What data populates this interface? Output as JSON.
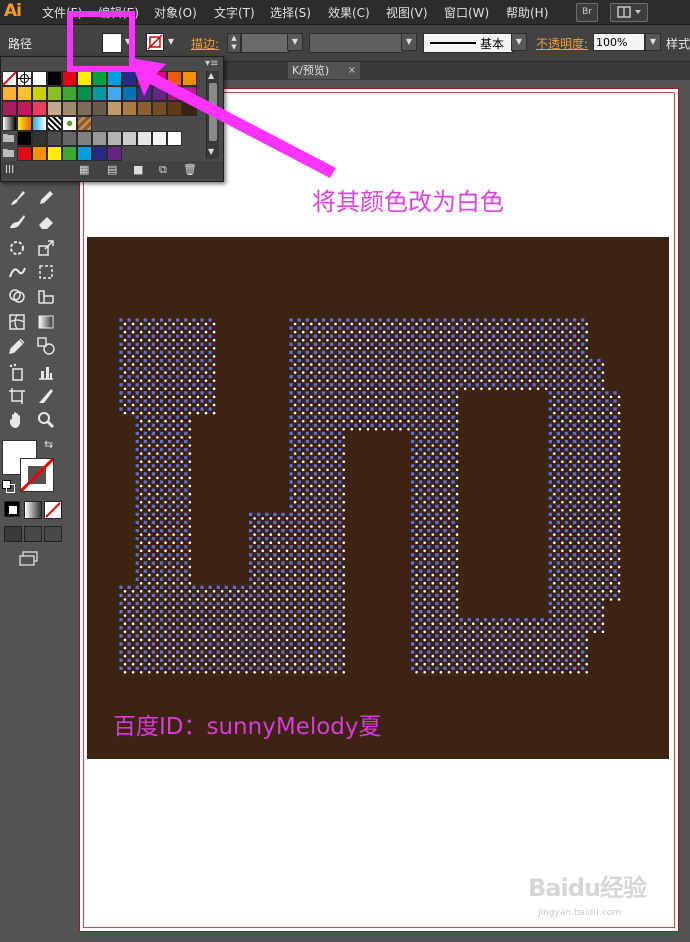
{
  "app": {
    "logo": "Ai"
  },
  "menubar": {
    "items": [
      {
        "label": "文件(F)",
        "name": "menu-file"
      },
      {
        "label": "编辑(E)",
        "name": "menu-edit"
      },
      {
        "label": "对象(O)",
        "name": "menu-object"
      },
      {
        "label": "文字(T)",
        "name": "menu-type"
      },
      {
        "label": "选择(S)",
        "name": "menu-select"
      },
      {
        "label": "效果(C)",
        "name": "menu-effect"
      },
      {
        "label": "视图(V)",
        "name": "menu-view"
      },
      {
        "label": "窗口(W)",
        "name": "menu-window"
      },
      {
        "label": "帮助(H)",
        "name": "menu-help"
      }
    ],
    "bridge_label": "Br"
  },
  "controlbar": {
    "selection_label": "路径",
    "stroke_label": "描边:",
    "brush_label": "基本",
    "opacity_label": "不透明度:",
    "opacity_value": "100%",
    "style_label": "样式"
  },
  "document_tab": {
    "title": "K/预览)",
    "close": "×"
  },
  "annotations": {
    "callout": "将其颜色改为白色",
    "credit": "百度ID：sunnyMelody夏"
  },
  "artwork": {
    "background_color": "#3d2311",
    "dot_color": "#ffffff",
    "anchor_color": "#5a6ef2",
    "text": "LED"
  },
  "watermark": {
    "line1": "Baidu经验",
    "line2": "jingyan.baidu.com"
  },
  "colors": {
    "highlight": "#ff33ff",
    "menubar": "#2c2c2c",
    "control_bar": "#424242",
    "canvas": "#535353",
    "accent_orange": "#f59d1e"
  },
  "swatches": {
    "rows": [
      [
        "none",
        "reg",
        "#ffffff",
        "#000000",
        "#e30613",
        "#ffed00",
        "#00a33c",
        "#009ee0",
        "#2a2a86",
        "#e6007e",
        "#e6007e",
        "#ea5b0c",
        "#f39200"
      ],
      [
        "#f9b233",
        "#fbc02d",
        "#c7d300",
        "#8cbf26",
        "#3aaa35",
        "#00924d",
        "#009aa5",
        "#3fa9f5",
        "#0073b7",
        "#4e2a84",
        "#662483",
        "#95197e",
        "#bd1a8d"
      ],
      [
        "#a71d5d",
        "#c8175d",
        "#e83e5f",
        "#c5a88f",
        "#9e8a6f",
        "#7e6d5a",
        "#6a5a49",
        "#c29c6b",
        "#ab7a45",
        "#8f5d30",
        "#754c24",
        "#603813",
        "#3d2311"
      ],
      [
        "grad1",
        "grad2",
        "grad3",
        "pat1",
        "pat2",
        "pat3"
      ],
      [
        "folder",
        "#000000",
        "#333333",
        "#4d4d4d",
        "#666666",
        "#808080",
        "#999999",
        "#b3b3b3",
        "#cccccc",
        "#e6e6e6",
        "#f2f2f2",
        "#ffffff"
      ],
      [
        "folder",
        "#e30613",
        "#f39200",
        "#ffed00",
        "#3aaa35",
        "#009ee0",
        "#2a2a86",
        "#662483"
      ]
    ]
  }
}
